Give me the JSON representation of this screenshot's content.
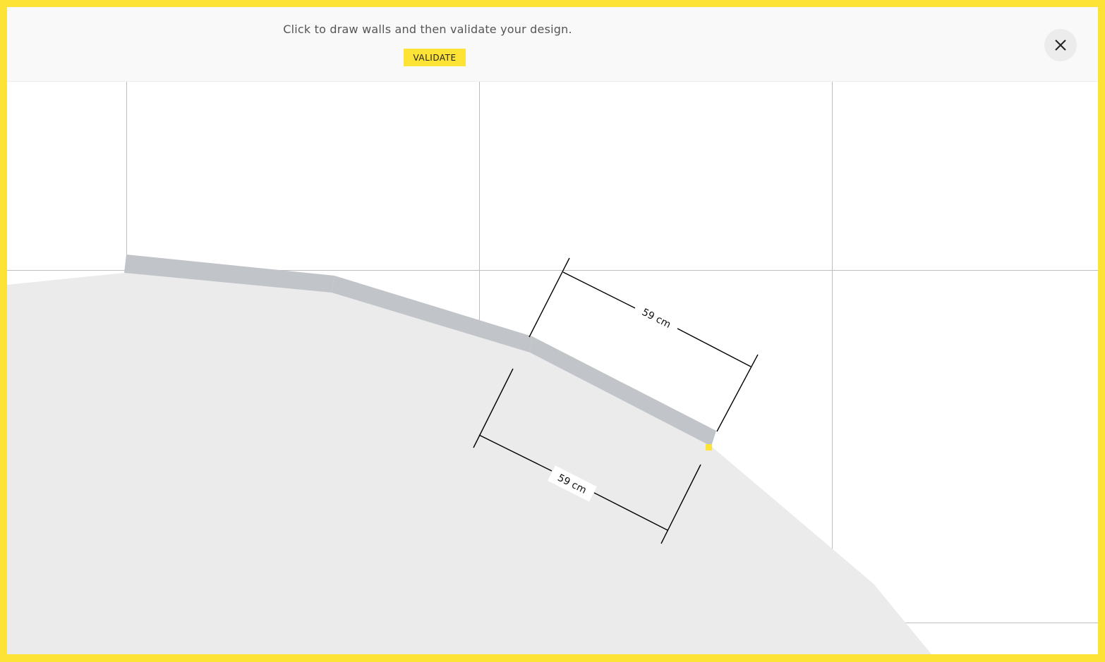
{
  "header": {
    "instruction": "Click to draw walls and then validate your design.",
    "validate_label": "VALIDATE",
    "close_icon": "close-icon"
  },
  "canvas": {
    "dimension_upper": "59 cm",
    "dimension_lower": "59 cm",
    "colors": {
      "accent": "#fde336",
      "wall": "#c1c4c8",
      "floor": "#ebebeb",
      "grid": "#bdbdbd"
    }
  }
}
